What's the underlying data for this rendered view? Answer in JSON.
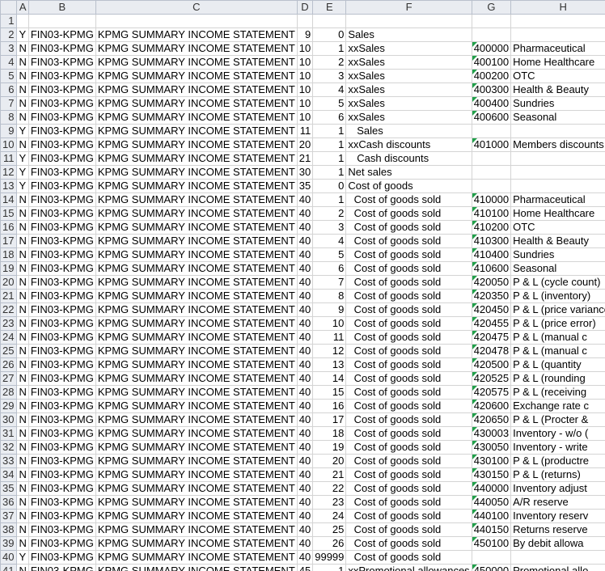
{
  "columns": [
    "A",
    "B",
    "C",
    "D",
    "E",
    "F",
    "G",
    "H"
  ],
  "rows": [
    {
      "n": "1",
      "a": "",
      "b": "",
      "c": "",
      "d": "",
      "e": "",
      "f": "",
      "g": "",
      "h": "",
      "tri": false
    },
    {
      "n": "2",
      "a": "Y",
      "b": "FIN03-KPMG",
      "c": "KPMG SUMMARY INCOME STATEMENT",
      "d": "9",
      "e": "0",
      "f": "Sales",
      "g": "",
      "h": "",
      "tri": false
    },
    {
      "n": "3",
      "a": "N",
      "b": "FIN03-KPMG",
      "c": "KPMG SUMMARY INCOME STATEMENT",
      "d": "10",
      "e": "1",
      "f": "xxSales",
      "g": "400000",
      "h": "Pharmaceutical",
      "tri": true
    },
    {
      "n": "4",
      "a": "N",
      "b": "FIN03-KPMG",
      "c": "KPMG SUMMARY INCOME STATEMENT",
      "d": "10",
      "e": "2",
      "f": "xxSales",
      "g": "400100",
      "h": "Home Healthcare",
      "tri": true
    },
    {
      "n": "5",
      "a": "N",
      "b": "FIN03-KPMG",
      "c": "KPMG SUMMARY INCOME STATEMENT",
      "d": "10",
      "e": "3",
      "f": "xxSales",
      "g": "400200",
      "h": "OTC",
      "tri": true
    },
    {
      "n": "6",
      "a": "N",
      "b": "FIN03-KPMG",
      "c": "KPMG SUMMARY INCOME STATEMENT",
      "d": "10",
      "e": "4",
      "f": "xxSales",
      "g": "400300",
      "h": "Health & Beauty",
      "tri": true
    },
    {
      "n": "7",
      "a": "N",
      "b": "FIN03-KPMG",
      "c": "KPMG SUMMARY INCOME STATEMENT",
      "d": "10",
      "e": "5",
      "f": "xxSales",
      "g": "400400",
      "h": "Sundries",
      "tri": true
    },
    {
      "n": "8",
      "a": "N",
      "b": "FIN03-KPMG",
      "c": "KPMG SUMMARY INCOME STATEMENT",
      "d": "10",
      "e": "6",
      "f": "xxSales",
      "g": "400600",
      "h": "Seasonal",
      "tri": true
    },
    {
      "n": "9",
      "a": "Y",
      "b": "FIN03-KPMG",
      "c": "KPMG SUMMARY INCOME STATEMENT",
      "d": "11",
      "e": "1",
      "f": "   Sales",
      "g": "",
      "h": "",
      "tri": false
    },
    {
      "n": "10",
      "a": "N",
      "b": "FIN03-KPMG",
      "c": "KPMG SUMMARY INCOME STATEMENT",
      "d": "20",
      "e": "1",
      "f": "xxCash discounts",
      "g": "401000",
      "h": "Members discounts",
      "tri": true
    },
    {
      "n": "11",
      "a": "Y",
      "b": "FIN03-KPMG",
      "c": "KPMG SUMMARY INCOME STATEMENT",
      "d": "21",
      "e": "1",
      "f": "   Cash discounts",
      "g": "",
      "h": "",
      "tri": false
    },
    {
      "n": "12",
      "a": "Y",
      "b": "FIN03-KPMG",
      "c": "KPMG SUMMARY INCOME STATEMENT",
      "d": "30",
      "e": "1",
      "f": "Net sales",
      "g": "",
      "h": "",
      "tri": false
    },
    {
      "n": "13",
      "a": "Y",
      "b": "FIN03-KPMG",
      "c": "KPMG SUMMARY INCOME STATEMENT",
      "d": "35",
      "e": "0",
      "f": "Cost of goods",
      "g": "",
      "h": "",
      "tri": false
    },
    {
      "n": "14",
      "a": "N",
      "b": "FIN03-KPMG",
      "c": "KPMG SUMMARY INCOME STATEMENT",
      "d": "40",
      "e": "1",
      "f": "  Cost of goods sold",
      "g": "410000",
      "h": "Pharmaceutical",
      "tri": true
    },
    {
      "n": "15",
      "a": "N",
      "b": "FIN03-KPMG",
      "c": "KPMG SUMMARY INCOME STATEMENT",
      "d": "40",
      "e": "2",
      "f": "  Cost of goods sold",
      "g": "410100",
      "h": "Home Healthcare",
      "tri": true
    },
    {
      "n": "16",
      "a": "N",
      "b": "FIN03-KPMG",
      "c": "KPMG SUMMARY INCOME STATEMENT",
      "d": "40",
      "e": "3",
      "f": "  Cost of goods sold",
      "g": "410200",
      "h": "OTC",
      "tri": true
    },
    {
      "n": "17",
      "a": "N",
      "b": "FIN03-KPMG",
      "c": "KPMG SUMMARY INCOME STATEMENT",
      "d": "40",
      "e": "4",
      "f": "  Cost of goods sold",
      "g": "410300",
      "h": "Health & Beauty",
      "tri": true
    },
    {
      "n": "18",
      "a": "N",
      "b": "FIN03-KPMG",
      "c": "KPMG SUMMARY INCOME STATEMENT",
      "d": "40",
      "e": "5",
      "f": "  Cost of goods sold",
      "g": "410400",
      "h": "Sundries",
      "tri": true
    },
    {
      "n": "19",
      "a": "N",
      "b": "FIN03-KPMG",
      "c": "KPMG SUMMARY INCOME STATEMENT",
      "d": "40",
      "e": "6",
      "f": "  Cost of goods sold",
      "g": "410600",
      "h": "Seasonal",
      "tri": true
    },
    {
      "n": "20",
      "a": "N",
      "b": "FIN03-KPMG",
      "c": "KPMG SUMMARY INCOME STATEMENT",
      "d": "40",
      "e": "7",
      "f": "  Cost of goods sold",
      "g": "420050",
      "h": "P & L (cycle count)",
      "tri": true
    },
    {
      "n": "21",
      "a": "N",
      "b": "FIN03-KPMG",
      "c": "KPMG SUMMARY INCOME STATEMENT",
      "d": "40",
      "e": "8",
      "f": "  Cost of goods sold",
      "g": "420350",
      "h": "P & L (inventory)",
      "tri": true
    },
    {
      "n": "22",
      "a": "N",
      "b": "FIN03-KPMG",
      "c": "KPMG SUMMARY INCOME STATEMENT",
      "d": "40",
      "e": "9",
      "f": "  Cost of goods sold",
      "g": "420450",
      "h": "P & L (price variance)",
      "tri": true
    },
    {
      "n": "23",
      "a": "N",
      "b": "FIN03-KPMG",
      "c": "KPMG SUMMARY INCOME STATEMENT",
      "d": "40",
      "e": "10",
      "f": "  Cost of goods sold",
      "g": "420455",
      "h": "P & L (price error)",
      "tri": true
    },
    {
      "n": "24",
      "a": "N",
      "b": "FIN03-KPMG",
      "c": "KPMG SUMMARY INCOME STATEMENT",
      "d": "40",
      "e": "11",
      "f": "  Cost of goods sold",
      "g": "420475",
      "h": "P & L (manual c",
      "tri": true
    },
    {
      "n": "25",
      "a": "N",
      "b": "FIN03-KPMG",
      "c": "KPMG SUMMARY INCOME STATEMENT",
      "d": "40",
      "e": "12",
      "f": "  Cost of goods sold",
      "g": "420478",
      "h": "P & L (manual c",
      "tri": true
    },
    {
      "n": "26",
      "a": "N",
      "b": "FIN03-KPMG",
      "c": "KPMG SUMMARY INCOME STATEMENT",
      "d": "40",
      "e": "13",
      "f": "  Cost of goods sold",
      "g": "420500",
      "h": "P & L (quantity",
      "tri": true
    },
    {
      "n": "27",
      "a": "N",
      "b": "FIN03-KPMG",
      "c": "KPMG SUMMARY INCOME STATEMENT",
      "d": "40",
      "e": "14",
      "f": "  Cost of goods sold",
      "g": "420525",
      "h": "P & L (rounding",
      "tri": true
    },
    {
      "n": "28",
      "a": "N",
      "b": "FIN03-KPMG",
      "c": "KPMG SUMMARY INCOME STATEMENT",
      "d": "40",
      "e": "15",
      "f": "  Cost of goods sold",
      "g": "420575",
      "h": "P & L (receiving",
      "tri": true
    },
    {
      "n": "29",
      "a": "N",
      "b": "FIN03-KPMG",
      "c": "KPMG SUMMARY INCOME STATEMENT",
      "d": "40",
      "e": "16",
      "f": "  Cost of goods sold",
      "g": "420600",
      "h": "Exchange rate c",
      "tri": true
    },
    {
      "n": "30",
      "a": "N",
      "b": "FIN03-KPMG",
      "c": "KPMG SUMMARY INCOME STATEMENT",
      "d": "40",
      "e": "17",
      "f": "  Cost of goods sold",
      "g": "420650",
      "h": "P & L (Procter &",
      "tri": true
    },
    {
      "n": "31",
      "a": "N",
      "b": "FIN03-KPMG",
      "c": "KPMG SUMMARY INCOME STATEMENT",
      "d": "40",
      "e": "18",
      "f": "  Cost of goods sold",
      "g": "430003",
      "h": "Inventory - w/o (",
      "tri": true
    },
    {
      "n": "32",
      "a": "N",
      "b": "FIN03-KPMG",
      "c": "KPMG SUMMARY INCOME STATEMENT",
      "d": "40",
      "e": "19",
      "f": "  Cost of goods sold",
      "g": "430050",
      "h": "Inventory - write",
      "tri": true
    },
    {
      "n": "33",
      "a": "N",
      "b": "FIN03-KPMG",
      "c": "KPMG SUMMARY INCOME STATEMENT",
      "d": "40",
      "e": "20",
      "f": "  Cost of goods sold",
      "g": "430100",
      "h": "P & L (productre",
      "tri": true
    },
    {
      "n": "34",
      "a": "N",
      "b": "FIN03-KPMG",
      "c": "KPMG SUMMARY INCOME STATEMENT",
      "d": "40",
      "e": "21",
      "f": "  Cost of goods sold",
      "g": "430150",
      "h": "P & L (returns)",
      "tri": true
    },
    {
      "n": "35",
      "a": "N",
      "b": "FIN03-KPMG",
      "c": "KPMG SUMMARY INCOME STATEMENT",
      "d": "40",
      "e": "22",
      "f": "  Cost of goods sold",
      "g": "440000",
      "h": "Inventory adjust",
      "tri": true
    },
    {
      "n": "36",
      "a": "N",
      "b": "FIN03-KPMG",
      "c": "KPMG SUMMARY INCOME STATEMENT",
      "d": "40",
      "e": "23",
      "f": "  Cost of goods sold",
      "g": "440050",
      "h": "A/R reserve",
      "tri": true
    },
    {
      "n": "37",
      "a": "N",
      "b": "FIN03-KPMG",
      "c": "KPMG SUMMARY INCOME STATEMENT",
      "d": "40",
      "e": "24",
      "f": "  Cost of goods sold",
      "g": "440100",
      "h": "Inventory reserv",
      "tri": true
    },
    {
      "n": "38",
      "a": "N",
      "b": "FIN03-KPMG",
      "c": "KPMG SUMMARY INCOME STATEMENT",
      "d": "40",
      "e": "25",
      "f": "  Cost of goods sold",
      "g": "440150",
      "h": "Returns reserve",
      "tri": true
    },
    {
      "n": "39",
      "a": "N",
      "b": "FIN03-KPMG",
      "c": "KPMG SUMMARY INCOME STATEMENT",
      "d": "40",
      "e": "26",
      "f": "  Cost of goods sold",
      "g": "450100",
      "h": "By debit allowa",
      "tri": true
    },
    {
      "n": "40",
      "a": "Y",
      "b": "FIN03-KPMG",
      "c": "KPMG SUMMARY INCOME STATEMENT",
      "d": "40",
      "e": "99999",
      "f": "  Cost of goods sold",
      "g": "",
      "h": "",
      "tri": false
    },
    {
      "n": "41",
      "a": "N",
      "b": "FIN03-KPMG",
      "c": "KPMG SUMMARY INCOME STATEMENT",
      "d": "45",
      "e": "1",
      "f": "xxPromotional allowances",
      "g": "450000",
      "h": "Promotional allo",
      "tri": true
    }
  ]
}
